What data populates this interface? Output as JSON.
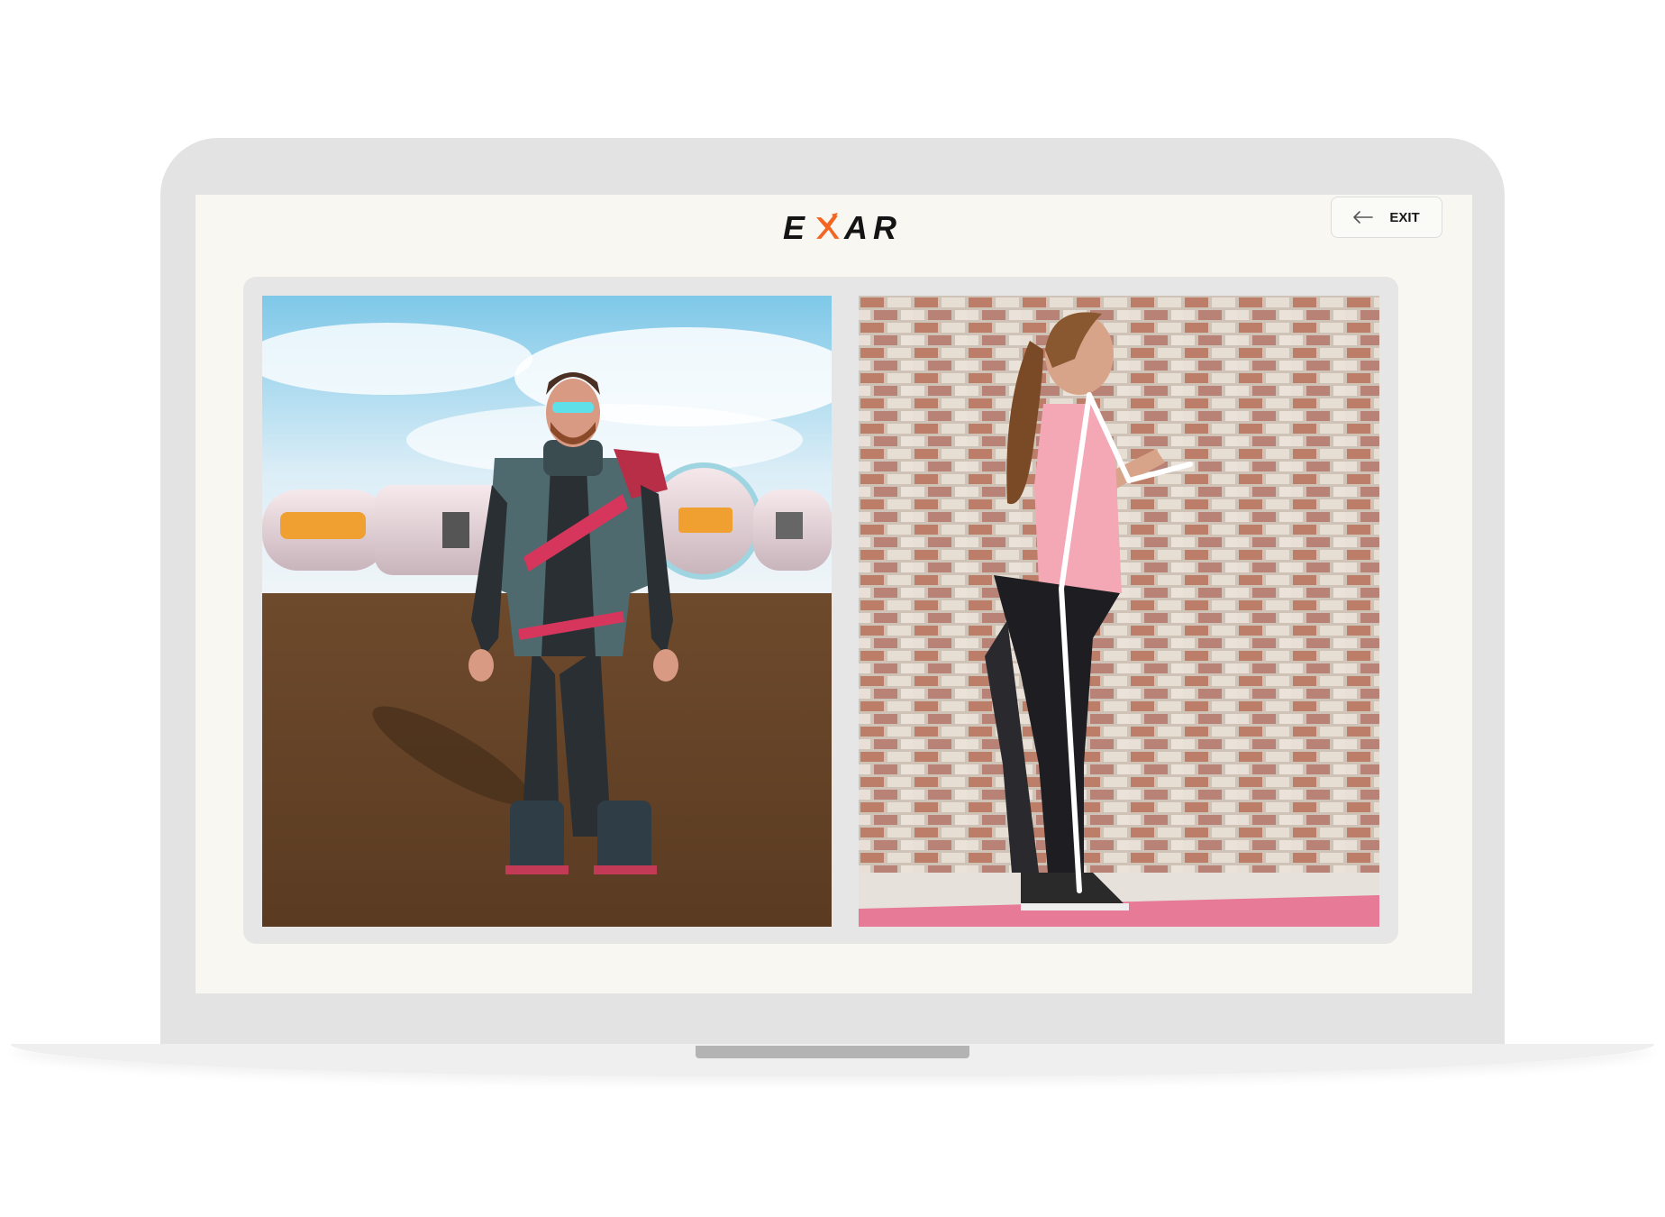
{
  "app": {
    "logo": {
      "left": "E",
      "right": "AR",
      "accent_color": "#f26522"
    },
    "exit_button": {
      "label": "EXIT",
      "icon": "arrow-left-icon"
    }
  },
  "panels": {
    "avatar_view": {
      "description_icon": "3d-avatar"
    },
    "camera_view": {
      "description_icon": "pose-skeleton-overlay"
    }
  },
  "colors": {
    "screen_bg": "#f8f7f1",
    "laptop_body": "#e3e3e3",
    "panel_frame": "#e6e6e6"
  }
}
